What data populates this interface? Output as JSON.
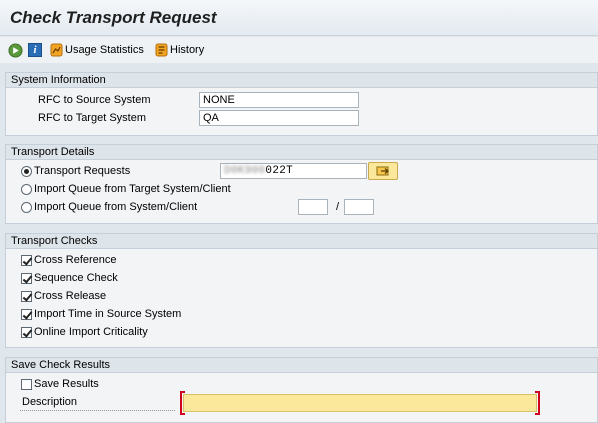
{
  "window": {
    "title": "Check Transport Request"
  },
  "toolbar": {
    "usage_label": "Usage Statistics",
    "history_label": "History",
    "info_glyph": "i",
    "icons": [
      "execute-icon",
      "info-icon",
      "usage-statistics-icon",
      "history-icon"
    ]
  },
  "system_info": {
    "header": "System Information",
    "rfc_source_label": "RFC to Source System",
    "rfc_source_value": "NONE",
    "rfc_target_label": "RFC to Target System",
    "rfc_target_value": "QA"
  },
  "transport_details": {
    "header": "Transport Details",
    "opt_requests": "Transport Requests",
    "request_hidden": "D0K900",
    "request_visible": "022T",
    "opt_queue_target": "Import Queue from Target System/Client",
    "opt_queue_system": "Import Queue from System/Client",
    "separator": "/",
    "system_value": "",
    "client_value": ""
  },
  "checks": {
    "header": "Transport Checks",
    "items": [
      {
        "label": "Cross Reference",
        "checked": true
      },
      {
        "label": "Sequence Check",
        "checked": true
      },
      {
        "label": "Cross Release",
        "checked": true
      },
      {
        "label": "Import Time in Source System",
        "checked": true
      },
      {
        "label": "Online Import Criticality",
        "checked": true
      }
    ]
  },
  "save": {
    "header": "Save Check Results",
    "save_label": "Save Results",
    "save_checked": false,
    "description_label": "Description",
    "description_value": ""
  },
  "colors": {
    "background": "#dfe6ec",
    "required_field": "#fbe89a",
    "required_marker": "#d0021b"
  }
}
